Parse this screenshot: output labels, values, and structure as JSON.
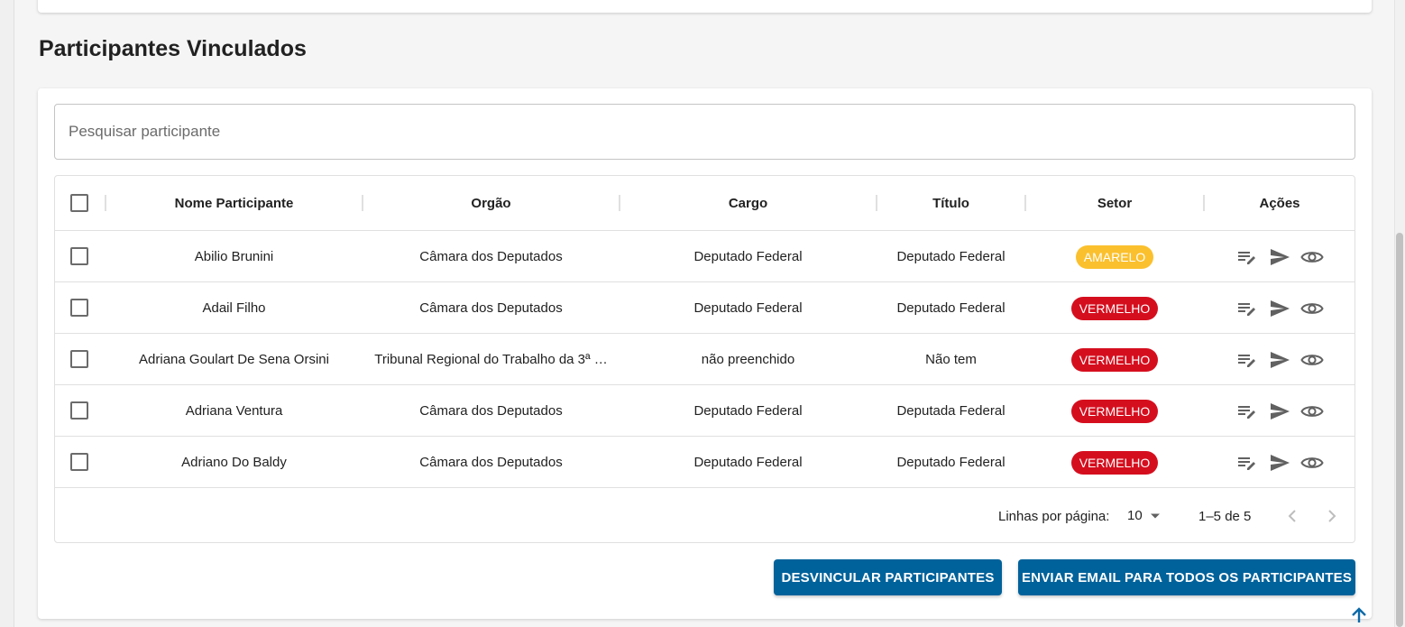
{
  "section": {
    "title": "Participantes Vinculados"
  },
  "search": {
    "placeholder": "Pesquisar participante",
    "value": ""
  },
  "table": {
    "columns": [
      "Nome Participante",
      "Orgão",
      "Cargo",
      "Título",
      "Setor",
      "Ações"
    ],
    "rows": [
      {
        "nome": "Abilio Brunini",
        "orgao": "Câmara dos Deputados",
        "cargo": "Deputado Federal",
        "titulo": "Deputado Federal",
        "setor": "AMARELO",
        "setor_color": "#fbc02d"
      },
      {
        "nome": "Adail Filho",
        "orgao": "Câmara dos Deputados",
        "cargo": "Deputado Federal",
        "titulo": "Deputado Federal",
        "setor": "VERMELHO",
        "setor_color": "#d50e1e"
      },
      {
        "nome": "Adriana Goulart De Sena Orsini",
        "orgao": "Tribunal Regional do Trabalho da 3ª …",
        "cargo": "não preenchido",
        "titulo": "Não tem",
        "setor": "VERMELHO",
        "setor_color": "#d50e1e"
      },
      {
        "nome": "Adriana Ventura",
        "orgao": "Câmara dos Deputados",
        "cargo": "Deputado Federal",
        "titulo": "Deputada Federal",
        "setor": "VERMELHO",
        "setor_color": "#d50e1e"
      },
      {
        "nome": "Adriano Do Baldy",
        "orgao": "Câmara dos Deputados",
        "cargo": "Deputado Federal",
        "titulo": "Deputado Federal",
        "setor": "VERMELHO",
        "setor_color": "#d50e1e"
      }
    ]
  },
  "pagination": {
    "rows_label": "Linhas por página:",
    "rows_per_page": "10",
    "range": "1–5 de 5"
  },
  "buttons": {
    "unlink": "DESVINCULAR PARTICIPANTES",
    "email_all": "ENVIAR EMAIL PARA TODOS OS PARTICIPANTES"
  },
  "colors": {
    "primary": "#00629b",
    "icon": "#616161"
  }
}
